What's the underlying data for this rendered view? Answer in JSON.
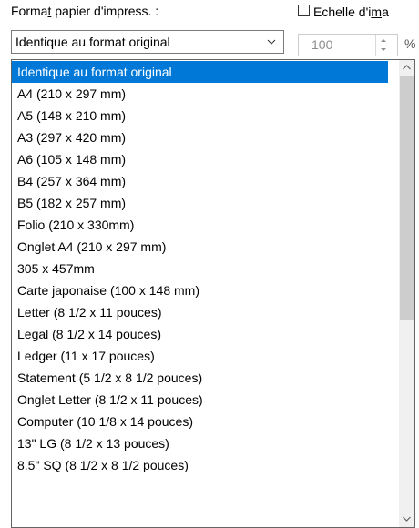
{
  "paper_format": {
    "label_before": "Forma",
    "label_mnemonic": "t",
    "label_after": " papier d'impress. :",
    "selected_value": "Identique au format original"
  },
  "scale": {
    "label_before": "Echelle d'i",
    "label_mnemonic": "m",
    "label_after": "a",
    "checked": false,
    "value": "100",
    "unit": "%"
  },
  "dropdown": {
    "options": [
      "Identique au format original",
      "A4 (210 x 297 mm)",
      "A5 (148 x 210 mm)",
      "A3 (297 x 420 mm)",
      "A6 (105 x 148 mm)",
      "B4 (257 x 364 mm)",
      "B5 (182 x 257 mm)",
      "Folio (210 x 330mm)",
      "Onglet A4 (210 x 297 mm)",
      "305 x 457mm",
      "Carte japonaise (100 x 148 mm)",
      "Letter (8 1/2 x 11 pouces)",
      "Legal (8 1/2 x 14 pouces)",
      "Ledger (11 x 17 pouces)",
      "Statement (5 1/2 x 8 1/2 pouces)",
      "Onglet Letter (8 1/2 x 11 pouces)",
      "Computer (10 1/8 x 14 pouces)",
      "13\" LG (8 1/2 x 13 pouces)",
      "8.5\" SQ (8 1/2 x 8 1/2 pouces)"
    ],
    "highlighted_index": 0
  },
  "icons": {
    "combo_arrow": "chevron-down-icon",
    "spin_up": "spin-up-icon",
    "spin_down": "spin-down-icon",
    "scroll_up": "scroll-up-arrow-icon",
    "scroll_down": "scroll-down-arrow-icon"
  },
  "colors": {
    "selection": "#0078d7",
    "selection_text": "#ffffff",
    "disabled_text": "#8c8c8c",
    "scroll_thumb": "#cdcdcd",
    "scroll_track": "#f0f0f0"
  }
}
